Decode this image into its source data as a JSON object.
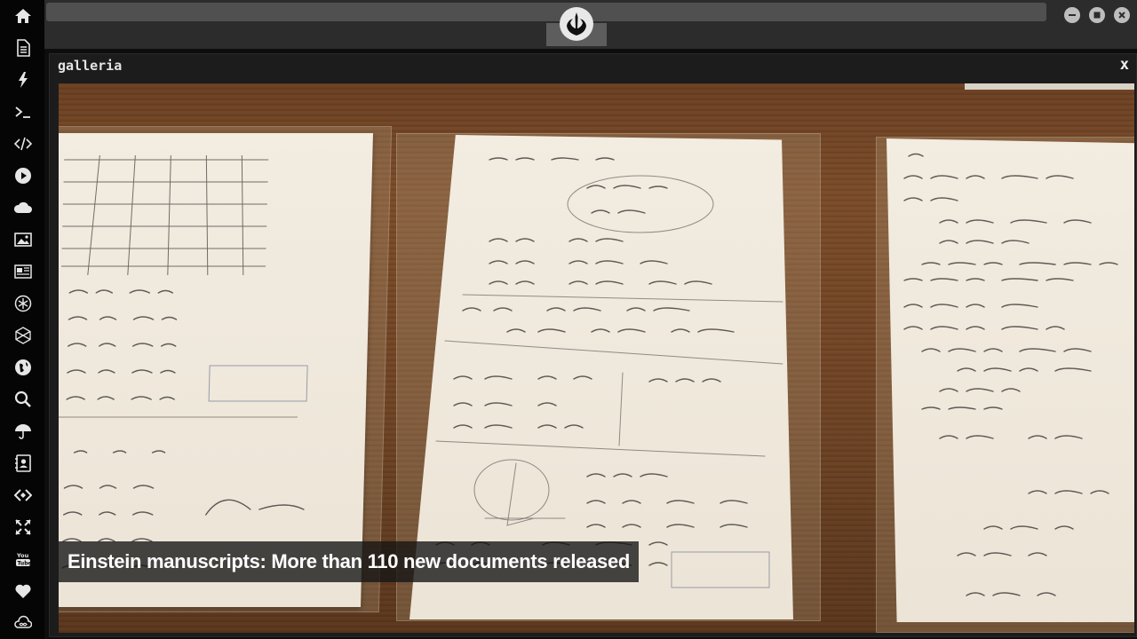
{
  "sidebar": {
    "items": [
      {
        "icon": "home-icon"
      },
      {
        "icon": "document-icon"
      },
      {
        "icon": "lightning-icon"
      },
      {
        "icon": "terminal-icon"
      },
      {
        "icon": "code-icon"
      },
      {
        "icon": "play-icon"
      },
      {
        "icon": "cloud-icon"
      },
      {
        "icon": "image-icon"
      },
      {
        "icon": "newspaper-icon"
      },
      {
        "icon": "snowflake-icon"
      },
      {
        "icon": "hexagon-icon"
      },
      {
        "icon": "globe-icon"
      },
      {
        "icon": "search-icon"
      },
      {
        "icon": "umbrella-icon"
      },
      {
        "icon": "contacts-icon"
      },
      {
        "icon": "diamond-code-icon"
      },
      {
        "icon": "expand-icon"
      },
      {
        "icon": "youtube-icon"
      },
      {
        "icon": "heart-icon"
      },
      {
        "icon": "infinity-cloud-icon"
      }
    ]
  },
  "topbar": {
    "logo_icon": "rebel-alliance-icon",
    "window_controls": [
      "minimize-icon",
      "maximize-icon",
      "close-icon"
    ]
  },
  "panel": {
    "title": "galleria",
    "close_label": "x"
  },
  "gallery": {
    "caption": "Einstein manuscripts: More than 110 new documents released"
  },
  "colors": {
    "sidebar_bg": "#050505",
    "topbar_bg": "#2c2c2c",
    "panel_bg": "#1c1c1c",
    "caption_bg": "#141414"
  }
}
